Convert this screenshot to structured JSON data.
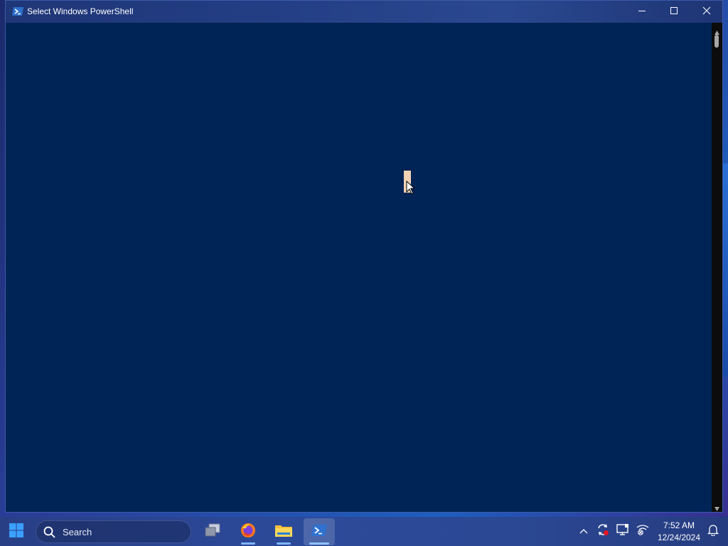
{
  "window": {
    "title": "Select Windows PowerShell",
    "icon": "powershell-icon",
    "controls": [
      "minimize-icon",
      "maximize-icon",
      "close-icon"
    ],
    "console_background": "#012456",
    "caret_color": "#f2d2b3"
  },
  "taskbar": {
    "search_placeholder": "Search",
    "apps": [
      {
        "name": "Task View",
        "icon": "task-view-icon"
      },
      {
        "name": "Firefox",
        "icon": "firefox-icon"
      },
      {
        "name": "File Explorer",
        "icon": "folder-icon"
      },
      {
        "name": "Windows PowerShell",
        "icon": "powershell-icon",
        "active": true
      }
    ],
    "tray": {
      "icons": [
        "chevron-up-icon",
        "sync-icon",
        "display-icon",
        "network-disconnected-icon",
        "notification-bell-icon"
      ],
      "time": "7:52 AM",
      "date": "12/24/2024"
    }
  }
}
